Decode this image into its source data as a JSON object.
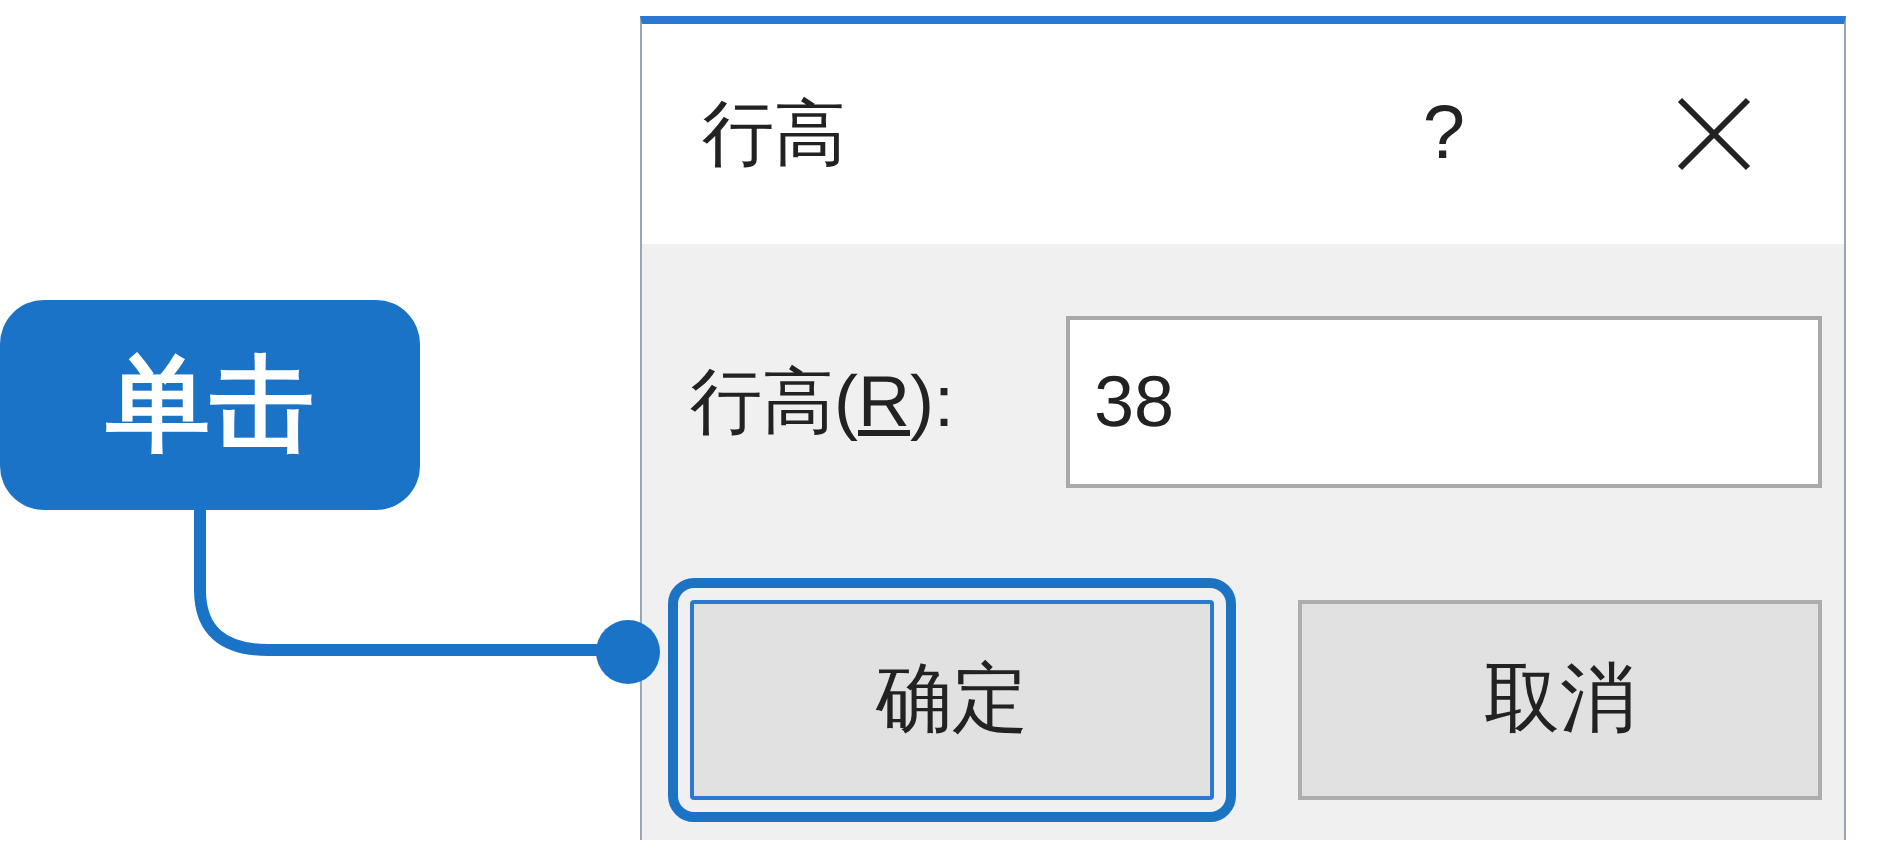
{
  "dialog": {
    "title": "行高",
    "help": "?",
    "field": {
      "label_before": "行高(",
      "accelerator": "R",
      "label_after": "):",
      "value": "38"
    },
    "buttons": [
      {
        "label": "确定",
        "highlighted": true
      },
      {
        "label": "取消",
        "highlighted": false
      }
    ]
  },
  "callout": {
    "text": "单击"
  }
}
